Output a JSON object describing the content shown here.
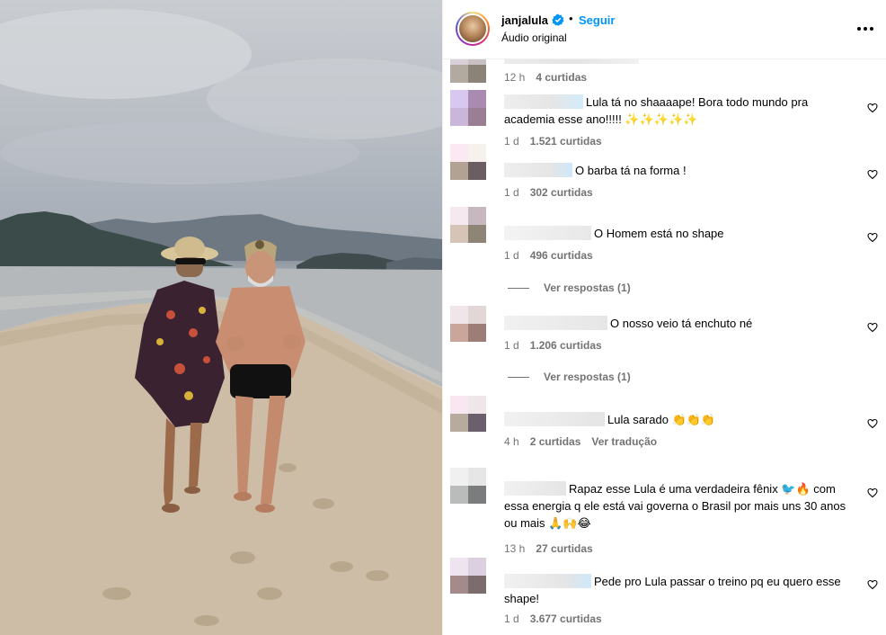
{
  "header": {
    "username": "janjalula",
    "separator": "•",
    "follow_label": "Seguir",
    "audio_label": "Áudio original",
    "verified_icon": "verified-badge-icon",
    "more_icon": "more-options-icon"
  },
  "colors": {
    "accent": "#0095f6",
    "muted": "#737373",
    "divider": "#efefef"
  },
  "comments": [
    {
      "text": "",
      "time": "12 h",
      "likes": "4 curtidas"
    },
    {
      "text": "Lula tá no shaaaape! Bora todo mundo pra academia esse ano!!!!! ✨✨✨✨✨",
      "time": "1 d",
      "likes": "1.521 curtidas"
    },
    {
      "text": "O barba tá na forma !",
      "time": "1 d",
      "likes": "302 curtidas"
    },
    {
      "text": "O Homem está no shape",
      "time": "1 d",
      "likes": "496 curtidas",
      "replies": "Ver respostas (1)"
    },
    {
      "text": "O nosso veio tá enchuto né",
      "time": "1 d",
      "likes": "1.206 curtidas",
      "replies": "Ver respostas (1)"
    },
    {
      "text": "Lula sarado 👏👏👏",
      "time": "4 h",
      "likes": "2 curtidas",
      "translate": "Ver tradução"
    },
    {
      "text": "Rapaz esse Lula é uma verdadeira fênix 🐦🔥 com essa energia q ele está vai governa o Brasil por mais uns 30 anos ou mais 🙏🙌😂",
      "time": "13 h",
      "likes": "27 curtidas"
    },
    {
      "text": "Pede pro Lula passar o treino pq eu quero esse shape!",
      "time": "1 d",
      "likes": "3.677 curtidas"
    }
  ]
}
